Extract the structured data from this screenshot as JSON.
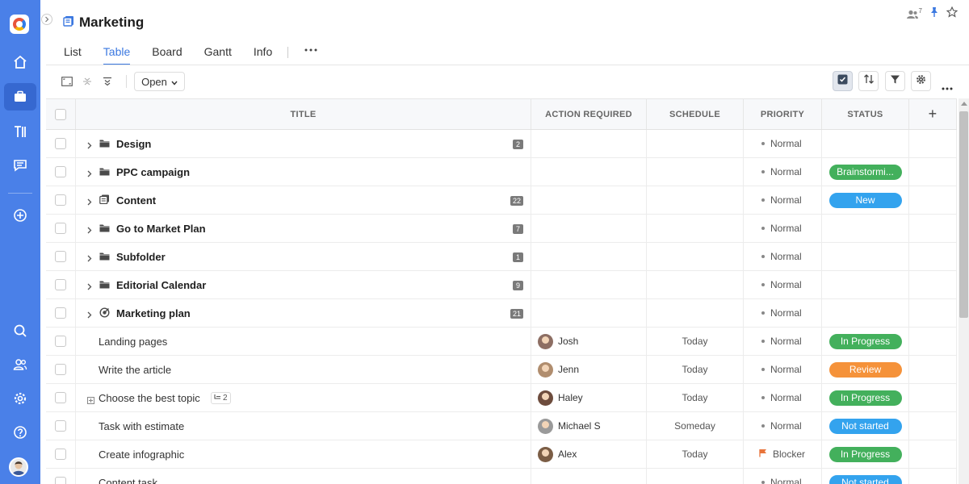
{
  "header": {
    "title": "Marketing",
    "member_count": "7"
  },
  "tabs": [
    {
      "label": "List"
    },
    {
      "label": "Table"
    },
    {
      "label": "Board"
    },
    {
      "label": "Gantt"
    },
    {
      "label": "Info"
    }
  ],
  "toolbar": {
    "filter_value": "Open"
  },
  "table": {
    "columns": {
      "title": "TITLE",
      "action": "ACTION REQUIRED",
      "schedule": "SCHEDULE",
      "priority": "PRIORITY",
      "status": "STATUS",
      "add": "+"
    },
    "rows": [
      {
        "kind": "folder",
        "icon": "folder-icon",
        "title": "Design",
        "count": "2",
        "priority": "Normal",
        "status": "",
        "status_color": ""
      },
      {
        "kind": "folder",
        "icon": "folder-icon",
        "title": "PPC campaign",
        "count": "",
        "priority": "Normal",
        "status": "Brainstormi...",
        "status_color": "#43b05c"
      },
      {
        "kind": "folder",
        "icon": "project-icon",
        "title": "Content",
        "count": "22",
        "priority": "Normal",
        "status": "New",
        "status_color": "#33a3ee"
      },
      {
        "kind": "folder",
        "icon": "folder-icon",
        "title": "Go to Market Plan",
        "count": "7",
        "priority": "Normal",
        "status": "",
        "status_color": ""
      },
      {
        "kind": "folder",
        "icon": "folder-icon",
        "title": "Subfolder",
        "count": "1",
        "priority": "Normal",
        "status": "",
        "status_color": ""
      },
      {
        "kind": "folder",
        "icon": "folder-icon",
        "title": "Editorial Calendar",
        "count": "9",
        "priority": "Normal",
        "status": "",
        "status_color": ""
      },
      {
        "kind": "folder",
        "icon": "goal-icon",
        "title": "Marketing plan",
        "count": "21",
        "priority": "Normal",
        "status": "",
        "status_color": ""
      },
      {
        "kind": "task",
        "title": "Landing pages",
        "assignee": "Josh",
        "schedule": "Today",
        "priority": "Normal",
        "status": "In Progress",
        "status_color": "#43b05c"
      },
      {
        "kind": "task",
        "title": "Write the article",
        "assignee": "Jenn",
        "schedule": "Today",
        "priority": "Normal",
        "status": "Review",
        "status_color": "#f5923a"
      },
      {
        "kind": "task",
        "title": "Choose the best topic",
        "subtasks": "2",
        "assignee": "Haley",
        "schedule": "Today",
        "priority": "Normal",
        "status": "In Progress",
        "status_color": "#43b05c"
      },
      {
        "kind": "task",
        "title": "Task with estimate",
        "assignee": "Michael S",
        "schedule": "Someday",
        "priority": "Normal",
        "status": "Not started",
        "status_color": "#33a3ee"
      },
      {
        "kind": "task",
        "title": "Create infographic",
        "assignee": "Alex",
        "schedule": "Today",
        "priority": "Blocker",
        "priority_flag": true,
        "status": "In Progress",
        "status_color": "#43b05c"
      },
      {
        "kind": "task",
        "title": "Content task",
        "assignee": "",
        "schedule": "",
        "priority": "Normal",
        "status": "Not started",
        "status_color": "#33a3ee"
      }
    ]
  }
}
